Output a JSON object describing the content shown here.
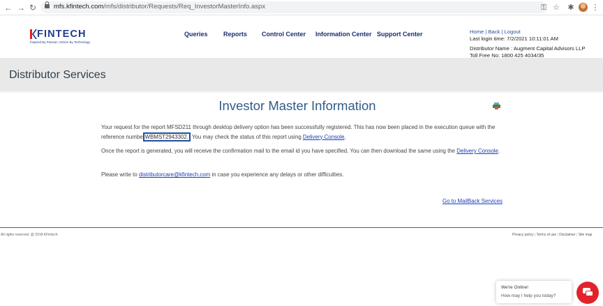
{
  "browser": {
    "url_host": "mfs.kfintech.com",
    "url_path": "/mfs/distributor/Requests/Req_InvestorMasterInfo.aspx",
    "icons": [
      "back-icon",
      "forward-icon",
      "reload-icon",
      "lock-icon",
      "key-icon",
      "star-icon",
      "extensions-icon",
      "profile-avatar",
      "more-icon"
    ]
  },
  "header": {
    "logo_text": "FINTECH",
    "logo_tagline": "Inspired By Passion. Driven By Technology.",
    "menu": [
      "Queries",
      "Reports",
      "Control Center",
      "Information Center",
      "Support Center"
    ],
    "links": {
      "home": "Home",
      "back": "Back",
      "logout": "Logout",
      "separator": " | "
    },
    "last_login": "Last login time: 7/2/2021 10:11:01 AM",
    "distributor_name": "Distributor Name : Augment Capital Advisors LLP",
    "toll_free": "Toll Free No: 1800 425 4034/35"
  },
  "banner": {
    "title": "Distributor Services"
  },
  "main": {
    "title": "Investor Master Information",
    "para1_before": "Your request for the report MFSD211 through desktop delivery option has been successfully registered. This has now been placed in the execution queue with the reference numbe",
    "reference_number": "WBMST2943302.",
    "para1_after": " You may check the status of this report using ",
    "delivery_console_link": "Delivery Console",
    "para1_end": ".",
    "para2_before": "Once the report is generated, you will receive the confirmation mail to the email id you have specified. You can then download the same using the ",
    "para2_link": "Delivery Console",
    "para2_end": ".",
    "para3_before": "Please write to ",
    "email": "distributorcare@kfintech.com",
    "para3_after": " in case you experience any delays or other difficulties.",
    "goto_link": "Go to MailBack Services"
  },
  "footer": {
    "copyright": "All rights reserved. @ 2018 KFintech",
    "links": [
      "Privacy policy",
      "Terms of use",
      "Disclaimer",
      "Site map"
    ],
    "separator": " | "
  },
  "chat": {
    "status": "We're Online!",
    "prompt": "How may I help you today?"
  },
  "colors": {
    "brand_blue": "#1e3c8c",
    "brand_red": "#ed1c24",
    "title_blue": "#2f5c8a",
    "link_blue": "#1a3fb3",
    "banner_grey": "#e9e9e9",
    "chat_red": "#e3232b"
  }
}
